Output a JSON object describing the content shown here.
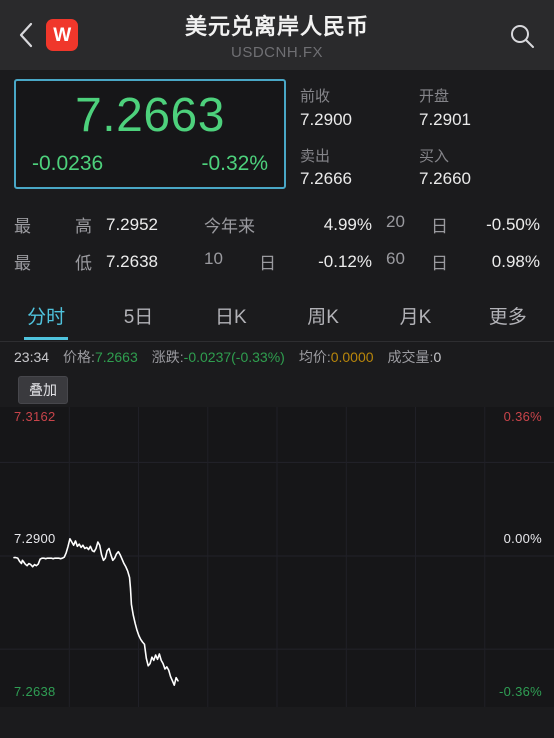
{
  "header": {
    "back_icon": "chevron-left-icon",
    "logo_text": "W",
    "title": "美元兑离岸人民币",
    "subtitle": "USDCNH.FX",
    "search_icon": "search-icon"
  },
  "quote": {
    "price": "7.2663",
    "change": "-0.0236",
    "change_pct": "-0.32%",
    "price_color": "#4dd17c",
    "box_border_color": "#49a7c6",
    "fields": [
      {
        "label": "前收",
        "value": "7.2900"
      },
      {
        "label": "开盘",
        "value": "7.2901"
      },
      {
        "label": "卖出",
        "value": "7.2666"
      },
      {
        "label": "买入",
        "value": "7.2660"
      }
    ]
  },
  "stats": {
    "row1": {
      "l1": "最",
      "l1b": "高",
      "v1": "7.2952",
      "l2": "今年来",
      "l2b": "",
      "v2": "4.99%",
      "l3": "20",
      "l3b": "日",
      "v3": "-0.50%"
    },
    "row2": {
      "l1": "最",
      "l1b": "低",
      "v1": "7.2638",
      "l2": "10",
      "l2b": "日",
      "v2": "-0.12%",
      "l3": "60",
      "l3b": "日",
      "v3": "0.98%"
    }
  },
  "tabs": [
    {
      "label": "分时",
      "active": true
    },
    {
      "label": "5日",
      "active": false
    },
    {
      "label": "日K",
      "active": false
    },
    {
      "label": "周K",
      "active": false
    },
    {
      "label": "月K",
      "active": false
    },
    {
      "label": "更多",
      "active": false
    }
  ],
  "infoline": {
    "time": "23:34",
    "price_key": "价格:",
    "price_val": "7.2663",
    "chg_key": "涨跌:",
    "chg_val": "-0.0237(-0.33%)",
    "avg_key": "均价:",
    "avg_val": "0.0000",
    "vol_key": "成交量:",
    "vol_val": "0"
  },
  "overlay": {
    "label": "叠加"
  },
  "chart_data": {
    "type": "line",
    "title": "",
    "xlabel": "",
    "ylabel": "",
    "axis_labels": {
      "top_left": "7.3162",
      "top_right": "0.36%",
      "mid_left": "7.2900",
      "mid_right": "0.00%",
      "bottom_left": "7.2638",
      "bottom_right": "-0.36%"
    },
    "ylim": [
      7.2638,
      7.3162
    ],
    "pct_lim": [
      -0.36,
      0.36
    ],
    "baseline": 7.29,
    "line_color": "#ffffff",
    "grid": true,
    "gridlines_y": [
      7.3074,
      7.29,
      7.2727
    ],
    "series": [
      {
        "name": "USDCNH 分时",
        "x": [
          0,
          2,
          4,
          6,
          8,
          9,
          10,
          12,
          14,
          16,
          18,
          20,
          22,
          24,
          26,
          28,
          30,
          32,
          34,
          36,
          38,
          40,
          42,
          44,
          46,
          48,
          50,
          52,
          54,
          56,
          58,
          60,
          62,
          64,
          66,
          68,
          70,
          72,
          74,
          76,
          78,
          80,
          82,
          84,
          86,
          88,
          90,
          92,
          94,
          96,
          98,
          100,
          102,
          104,
          106,
          108,
          110,
          112,
          114,
          116,
          118,
          120,
          122,
          124,
          125,
          126,
          128,
          130,
          132,
          134,
          136,
          138,
          140,
          142,
          144,
          146,
          148,
          150,
          152,
          154,
          156,
          158,
          160,
          162,
          164,
          166,
          168,
          170,
          172,
          174,
          176
        ],
        "y": [
          7.2897,
          7.2897,
          7.2896,
          7.289,
          7.2886,
          7.2892,
          7.289,
          7.2885,
          7.2882,
          7.2886,
          7.2884,
          7.288,
          7.2884,
          7.2882,
          7.2885,
          7.2894,
          7.2896,
          7.2896,
          7.2895,
          7.2896,
          7.2896,
          7.2896,
          7.2895,
          7.2896,
          7.2896,
          7.2896,
          7.2895,
          7.2896,
          7.2898,
          7.2906,
          7.2918,
          7.2932,
          7.2926,
          7.292,
          7.2928,
          7.2918,
          7.2922,
          7.2916,
          7.292,
          7.2914,
          7.2916,
          7.2912,
          7.2918,
          7.291,
          7.2908,
          7.2914,
          7.2926,
          7.292,
          7.2902,
          7.2892,
          7.2896,
          7.291,
          7.2914,
          7.2902,
          7.2892,
          7.2896,
          7.2904,
          7.2908,
          7.2902,
          7.2894,
          7.2886,
          7.288,
          7.2872,
          7.286,
          7.284,
          7.281,
          7.279,
          7.2775,
          7.2762,
          7.2752,
          7.2745,
          7.274,
          7.2736,
          7.271,
          7.2696,
          7.27,
          7.2712,
          7.2706,
          7.2716,
          7.2708,
          7.2718,
          7.2706,
          7.27,
          7.269,
          7.2694,
          7.2688,
          7.2676,
          7.2668,
          7.266,
          7.2674,
          7.2668
        ]
      }
    ]
  }
}
